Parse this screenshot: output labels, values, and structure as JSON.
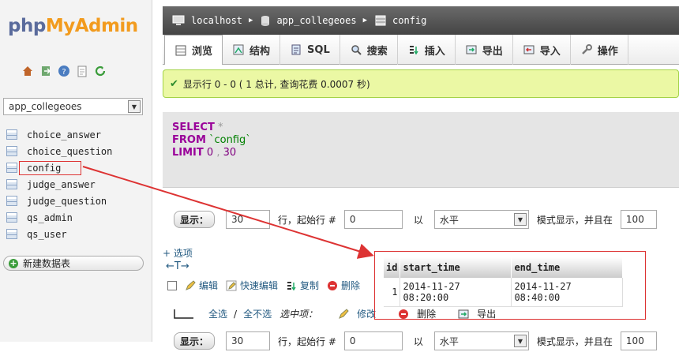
{
  "logo": {
    "part1": "php",
    "part2": "MyAdmin"
  },
  "left": {
    "database": "app_collegeoes",
    "tables": [
      "choice_answer",
      "choice_question",
      "config",
      "judge_answer",
      "judge_question",
      "qs_admin",
      "qs_user"
    ],
    "new_table": "新建数据表"
  },
  "breadcrumb": {
    "server": "localhost",
    "db": "app_collegeoes",
    "table": "config"
  },
  "tabs": [
    "浏览",
    "结构",
    "SQL",
    "搜索",
    "插入",
    "导出",
    "导入",
    "操作"
  ],
  "success": "显示行 0 - 0 ( 1 总计, 查询花费 0.0007 秒)",
  "sql": {
    "select": "SELECT",
    "star": "*",
    "from": "FROM",
    "table": "`config`",
    "limit": "LIMIT",
    "n0": "0",
    "comma": ",",
    "n30": "30"
  },
  "nav": {
    "show_btn": "显示：",
    "rows": "30",
    "start_label": "行，起始行 #",
    "start": "0",
    "in_label": "以",
    "mode": "水平",
    "mode_label": "模式显示，并且在",
    "repeat": "100"
  },
  "options": "+ 选项",
  "arrows": "←T→",
  "columns": [
    "id",
    "start_time",
    "end_time"
  ],
  "rows": [
    [
      "1",
      "2014-11-27 08:20:00",
      "2014-11-27 08:40:00"
    ]
  ],
  "row_actions": {
    "edit": "编辑",
    "quick_edit": "快速编辑",
    "copy": "复制",
    "delete": "删除"
  },
  "bottom": {
    "check_all": "全选",
    "sep": "/",
    "uncheck_all": "全不选",
    "selected": "选中项：",
    "change": "修改",
    "delete": "删除",
    "export": "导出"
  },
  "colors": {
    "accent": "#235a81",
    "highlight": "#dd3333",
    "success_bg": "#ebf8a4"
  }
}
